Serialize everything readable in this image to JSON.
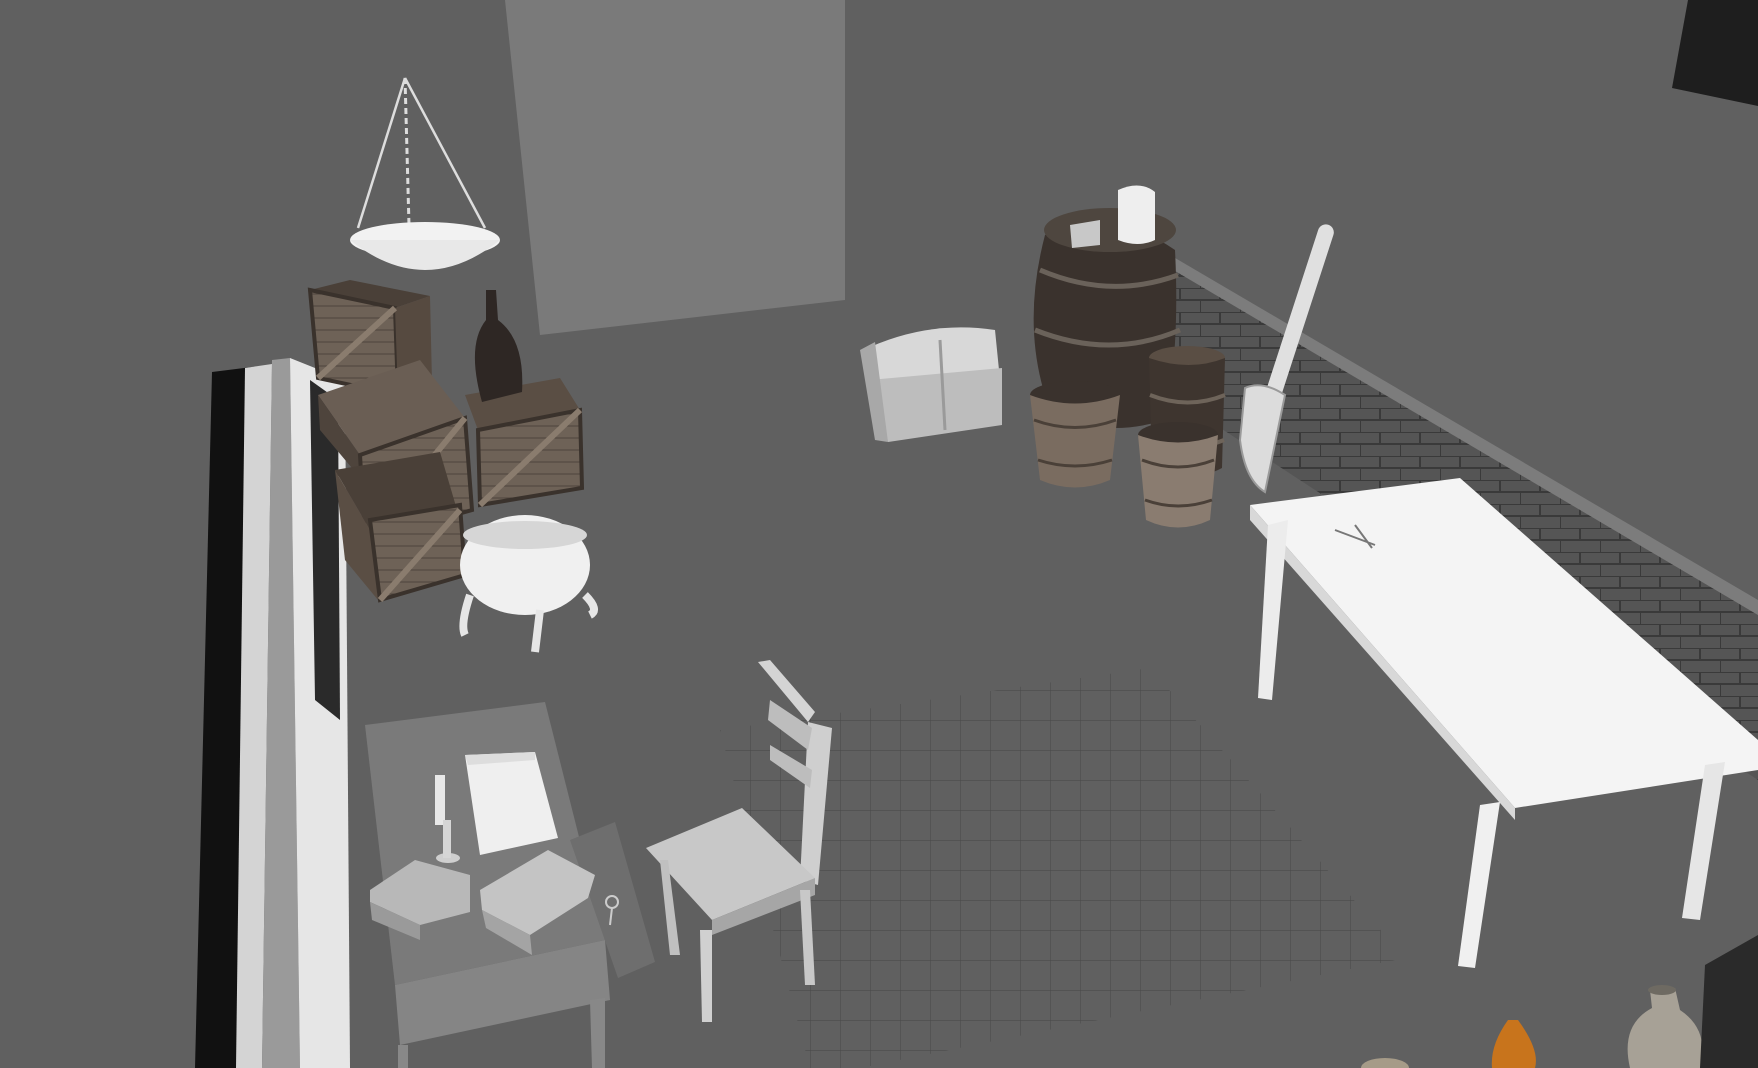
{
  "viewport": {
    "background": "#5f5f5f",
    "render_mode": "shaded"
  },
  "colors": {
    "wall": "#797979",
    "floor": "#5f5f5f",
    "wood_dark": "#3d3530",
    "wood_light": "#7a6a5a",
    "clay": "#b8b8b8",
    "white_prop": "#efefef",
    "brick": "#4a4a4a",
    "grid": "#4f4f4f"
  },
  "scene_objects": [
    "hanging-scale",
    "stacked-crates",
    "dark-bottle",
    "cauldron",
    "treasure-chest",
    "wine-barrel",
    "small-barrel",
    "wooden-buckets",
    "shovel",
    "brick-wall",
    "white-table",
    "desk",
    "books",
    "candle",
    "chair",
    "floor-grid",
    "clay-vase",
    "orange-gourd"
  ]
}
